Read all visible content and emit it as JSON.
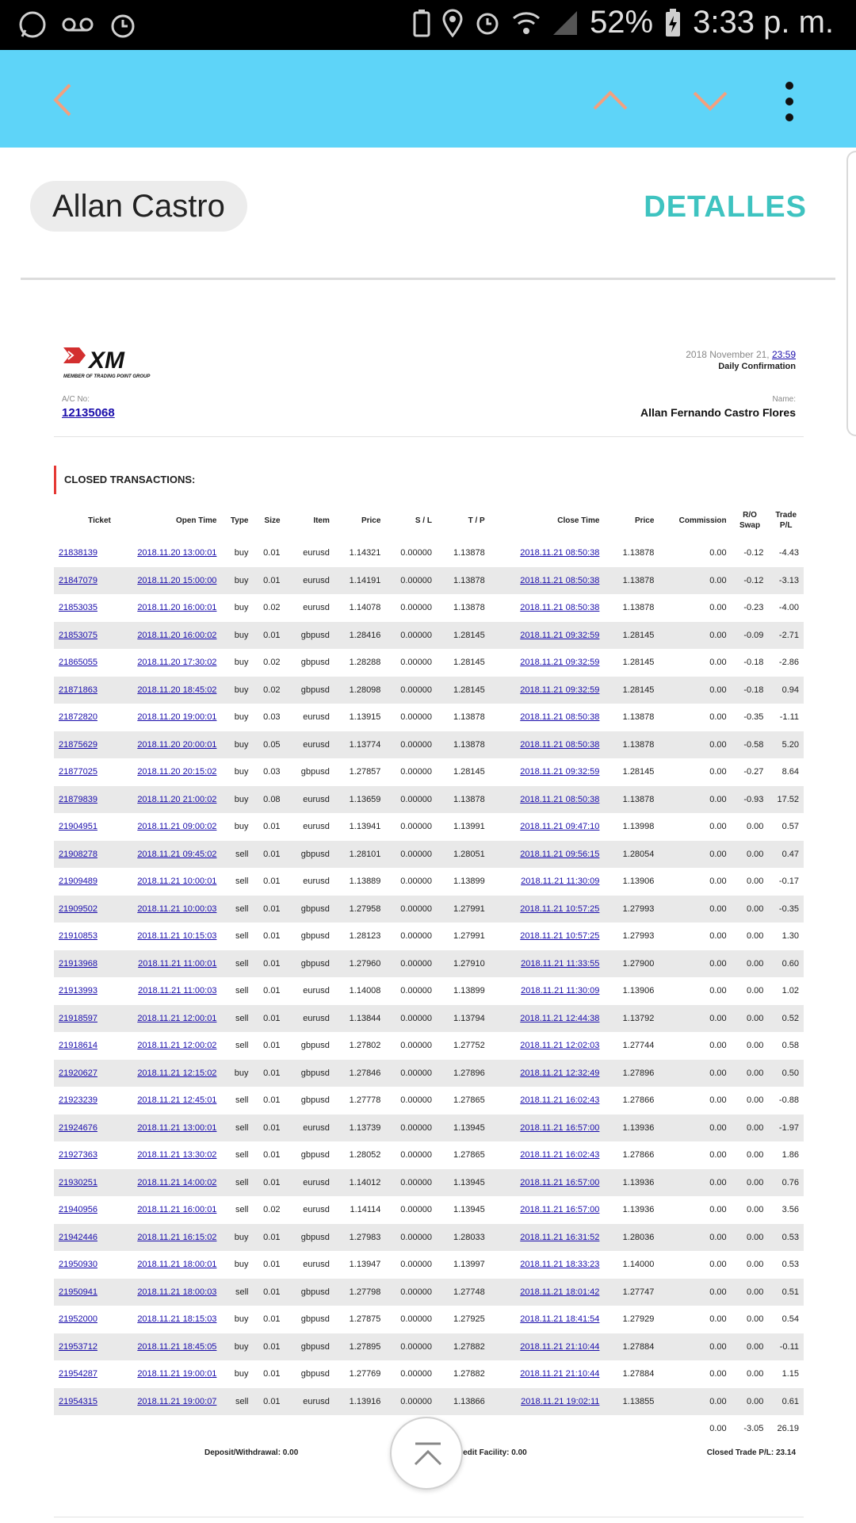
{
  "status_bar": {
    "battery": "52%",
    "time": "3:33 p. m."
  },
  "app_bar": {
    "back_icon": "back-arrow-icon",
    "up_icon": "chevron-up-icon",
    "down_icon": "chevron-down-icon",
    "menu_icon": "more-vert-icon",
    "bg_color": "#5ed4f8"
  },
  "header": {
    "name": "Allan Castro",
    "details_button": "DETALLES",
    "accent": "#3ec3c0"
  },
  "document": {
    "logo_text": "XM",
    "logo_sub": "MEMBER OF TRADING POINT GROUP",
    "date_prefix": "2018 November 21, ",
    "date_time": "23:59",
    "confirmation": "Daily Confirmation",
    "acno_label": "A/C No:",
    "acno": "12135068",
    "name_label": "Name:",
    "full_name": "Allan Fernando Castro Flores",
    "section_title": "CLOSED TRANSACTIONS:"
  },
  "columns": [
    "Ticket",
    "Open Time",
    "Type",
    "Size",
    "Item",
    "Price",
    "S / L",
    "T / P",
    "Close Time",
    "Price",
    "Commission",
    "R/O Swap",
    "Trade P/L"
  ],
  "rows": [
    [
      "21838139",
      "2018.11.20 13:00:01",
      "buy",
      "0.01",
      "eurusd",
      "1.14321",
      "0.00000",
      "1.13878",
      "2018.11.21 08:50:38",
      "1.13878",
      "0.00",
      "-0.12",
      "-4.43"
    ],
    [
      "21847079",
      "2018.11.20 15:00:00",
      "buy",
      "0.01",
      "eurusd",
      "1.14191",
      "0.00000",
      "1.13878",
      "2018.11.21 08:50:38",
      "1.13878",
      "0.00",
      "-0.12",
      "-3.13"
    ],
    [
      "21853035",
      "2018.11.20 16:00:01",
      "buy",
      "0.02",
      "eurusd",
      "1.14078",
      "0.00000",
      "1.13878",
      "2018.11.21 08:50:38",
      "1.13878",
      "0.00",
      "-0.23",
      "-4.00"
    ],
    [
      "21853075",
      "2018.11.20 16:00:02",
      "buy",
      "0.01",
      "gbpusd",
      "1.28416",
      "0.00000",
      "1.28145",
      "2018.11.21 09:32:59",
      "1.28145",
      "0.00",
      "-0.09",
      "-2.71"
    ],
    [
      "21865055",
      "2018.11.20 17:30:02",
      "buy",
      "0.02",
      "gbpusd",
      "1.28288",
      "0.00000",
      "1.28145",
      "2018.11.21 09:32:59",
      "1.28145",
      "0.00",
      "-0.18",
      "-2.86"
    ],
    [
      "21871863",
      "2018.11.20 18:45:02",
      "buy",
      "0.02",
      "gbpusd",
      "1.28098",
      "0.00000",
      "1.28145",
      "2018.11.21 09:32:59",
      "1.28145",
      "0.00",
      "-0.18",
      "0.94"
    ],
    [
      "21872820",
      "2018.11.20 19:00:01",
      "buy",
      "0.03",
      "eurusd",
      "1.13915",
      "0.00000",
      "1.13878",
      "2018.11.21 08:50:38",
      "1.13878",
      "0.00",
      "-0.35",
      "-1.11"
    ],
    [
      "21875629",
      "2018.11.20 20:00:01",
      "buy",
      "0.05",
      "eurusd",
      "1.13774",
      "0.00000",
      "1.13878",
      "2018.11.21 08:50:38",
      "1.13878",
      "0.00",
      "-0.58",
      "5.20"
    ],
    [
      "21877025",
      "2018.11.20 20:15:02",
      "buy",
      "0.03",
      "gbpusd",
      "1.27857",
      "0.00000",
      "1.28145",
      "2018.11.21 09:32:59",
      "1.28145",
      "0.00",
      "-0.27",
      "8.64"
    ],
    [
      "21879839",
      "2018.11.20 21:00:02",
      "buy",
      "0.08",
      "eurusd",
      "1.13659",
      "0.00000",
      "1.13878",
      "2018.11.21 08:50:38",
      "1.13878",
      "0.00",
      "-0.93",
      "17.52"
    ],
    [
      "21904951",
      "2018.11.21 09:00:02",
      "buy",
      "0.01",
      "eurusd",
      "1.13941",
      "0.00000",
      "1.13991",
      "2018.11.21 09:47:10",
      "1.13998",
      "0.00",
      "0.00",
      "0.57"
    ],
    [
      "21908278",
      "2018.11.21 09:45:02",
      "sell",
      "0.01",
      "gbpusd",
      "1.28101",
      "0.00000",
      "1.28051",
      "2018.11.21 09:56:15",
      "1.28054",
      "0.00",
      "0.00",
      "0.47"
    ],
    [
      "21909489",
      "2018.11.21 10:00:01",
      "sell",
      "0.01",
      "eurusd",
      "1.13889",
      "0.00000",
      "1.13899",
      "2018.11.21 11:30:09",
      "1.13906",
      "0.00",
      "0.00",
      "-0.17"
    ],
    [
      "21909502",
      "2018.11.21 10:00:03",
      "sell",
      "0.01",
      "gbpusd",
      "1.27958",
      "0.00000",
      "1.27991",
      "2018.11.21 10:57:25",
      "1.27993",
      "0.00",
      "0.00",
      "-0.35"
    ],
    [
      "21910853",
      "2018.11.21 10:15:03",
      "sell",
      "0.01",
      "gbpusd",
      "1.28123",
      "0.00000",
      "1.27991",
      "2018.11.21 10:57:25",
      "1.27993",
      "0.00",
      "0.00",
      "1.30"
    ],
    [
      "21913968",
      "2018.11.21 11:00:01",
      "sell",
      "0.01",
      "gbpusd",
      "1.27960",
      "0.00000",
      "1.27910",
      "2018.11.21 11:33:55",
      "1.27900",
      "0.00",
      "0.00",
      "0.60"
    ],
    [
      "21913993",
      "2018.11.21 11:00:03",
      "sell",
      "0.01",
      "eurusd",
      "1.14008",
      "0.00000",
      "1.13899",
      "2018.11.21 11:30:09",
      "1.13906",
      "0.00",
      "0.00",
      "1.02"
    ],
    [
      "21918597",
      "2018.11.21 12:00:01",
      "sell",
      "0.01",
      "eurusd",
      "1.13844",
      "0.00000",
      "1.13794",
      "2018.11.21 12:44:38",
      "1.13792",
      "0.00",
      "0.00",
      "0.52"
    ],
    [
      "21918614",
      "2018.11.21 12:00:02",
      "sell",
      "0.01",
      "gbpusd",
      "1.27802",
      "0.00000",
      "1.27752",
      "2018.11.21 12:02:03",
      "1.27744",
      "0.00",
      "0.00",
      "0.58"
    ],
    [
      "21920627",
      "2018.11.21 12:15:02",
      "buy",
      "0.01",
      "gbpusd",
      "1.27846",
      "0.00000",
      "1.27896",
      "2018.11.21 12:32:49",
      "1.27896",
      "0.00",
      "0.00",
      "0.50"
    ],
    [
      "21923239",
      "2018.11.21 12:45:01",
      "sell",
      "0.01",
      "gbpusd",
      "1.27778",
      "0.00000",
      "1.27865",
      "2018.11.21 16:02:43",
      "1.27866",
      "0.00",
      "0.00",
      "-0.88"
    ],
    [
      "21924676",
      "2018.11.21 13:00:01",
      "sell",
      "0.01",
      "eurusd",
      "1.13739",
      "0.00000",
      "1.13945",
      "2018.11.21 16:57:00",
      "1.13936",
      "0.00",
      "0.00",
      "-1.97"
    ],
    [
      "21927363",
      "2018.11.21 13:30:02",
      "sell",
      "0.01",
      "gbpusd",
      "1.28052",
      "0.00000",
      "1.27865",
      "2018.11.21 16:02:43",
      "1.27866",
      "0.00",
      "0.00",
      "1.86"
    ],
    [
      "21930251",
      "2018.11.21 14:00:02",
      "sell",
      "0.01",
      "eurusd",
      "1.14012",
      "0.00000",
      "1.13945",
      "2018.11.21 16:57:00",
      "1.13936",
      "0.00",
      "0.00",
      "0.76"
    ],
    [
      "21940956",
      "2018.11.21 16:00:01",
      "sell",
      "0.02",
      "eurusd",
      "1.14114",
      "0.00000",
      "1.13945",
      "2018.11.21 16:57:00",
      "1.13936",
      "0.00",
      "0.00",
      "3.56"
    ],
    [
      "21942446",
      "2018.11.21 16:15:02",
      "buy",
      "0.01",
      "gbpusd",
      "1.27983",
      "0.00000",
      "1.28033",
      "2018.11.21 16:31:52",
      "1.28036",
      "0.00",
      "0.00",
      "0.53"
    ],
    [
      "21950930",
      "2018.11.21 18:00:01",
      "buy",
      "0.01",
      "eurusd",
      "1.13947",
      "0.00000",
      "1.13997",
      "2018.11.21 18:33:23",
      "1.14000",
      "0.00",
      "0.00",
      "0.53"
    ],
    [
      "21950941",
      "2018.11.21 18:00:03",
      "sell",
      "0.01",
      "gbpusd",
      "1.27798",
      "0.00000",
      "1.27748",
      "2018.11.21 18:01:42",
      "1.27747",
      "0.00",
      "0.00",
      "0.51"
    ],
    [
      "21952000",
      "2018.11.21 18:15:03",
      "buy",
      "0.01",
      "gbpusd",
      "1.27875",
      "0.00000",
      "1.27925",
      "2018.11.21 18:41:54",
      "1.27929",
      "0.00",
      "0.00",
      "0.54"
    ],
    [
      "21953712",
      "2018.11.21 18:45:05",
      "buy",
      "0.01",
      "gbpusd",
      "1.27895",
      "0.00000",
      "1.27882",
      "2018.11.21 21:10:44",
      "1.27884",
      "0.00",
      "0.00",
      "-0.11"
    ],
    [
      "21954287",
      "2018.11.21 19:00:01",
      "buy",
      "0.01",
      "gbpusd",
      "1.27769",
      "0.00000",
      "1.27882",
      "2018.11.21 21:10:44",
      "1.27884",
      "0.00",
      "0.00",
      "1.15"
    ],
    [
      "21954315",
      "2018.11.21 19:00:07",
      "sell",
      "0.01",
      "eurusd",
      "1.13916",
      "0.00000",
      "1.13866",
      "2018.11.21 19:02:11",
      "1.13855",
      "0.00",
      "0.00",
      "0.61"
    ]
  ],
  "totals": {
    "commission": "0.00",
    "swap": "-3.05",
    "pl": "26.19"
  },
  "summary": {
    "deposit": "Deposit/Withdrawal: 0.00",
    "credit": "Credit Facility: 0.00",
    "closed": "Closed Trade P/L: 23.14"
  },
  "fab_icon": "scroll-to-top-icon"
}
